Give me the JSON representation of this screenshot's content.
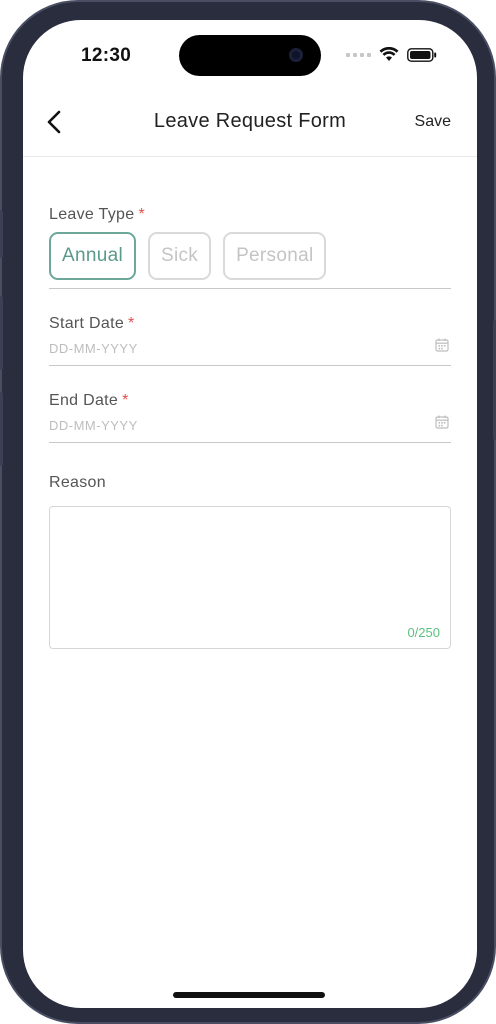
{
  "status_bar": {
    "time": "12:30"
  },
  "header": {
    "title": "Leave Request Form",
    "save_label": "Save"
  },
  "form": {
    "leave_type": {
      "label": "Leave Type",
      "required_mark": "*",
      "options": [
        "Annual",
        "Sick",
        "Personal"
      ],
      "selected": "Annual"
    },
    "start_date": {
      "label": "Start Date",
      "required_mark": "*",
      "placeholder": "DD-MM-YYYY"
    },
    "end_date": {
      "label": "End Date",
      "required_mark": "*",
      "placeholder": "DD-MM-YYYY"
    },
    "reason": {
      "label": "Reason",
      "counter": "0/250"
    }
  },
  "colors": {
    "accent": "#5a9a8a",
    "required": "#e25050",
    "counter": "#5cbf7e"
  }
}
